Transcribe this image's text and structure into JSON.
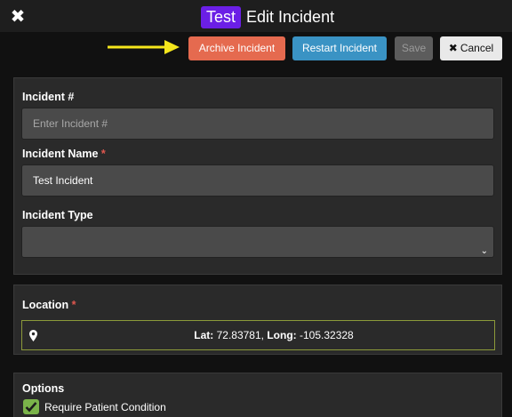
{
  "header": {
    "close_icon": "close-x-icon",
    "badge": "Test",
    "title": "Edit Incident",
    "badge_color": "#6b1fe6"
  },
  "toolbar": {
    "archive_label": "Archive Incident",
    "restart_label": "Restart Incident",
    "save_label": "Save",
    "cancel_label": "Cancel",
    "cancel_icon": "✖",
    "archive_color": "#e56a4f",
    "restart_color": "#3a93c4"
  },
  "form": {
    "incident_number": {
      "label": "Incident #",
      "placeholder": "Enter Incident #",
      "value": ""
    },
    "incident_name": {
      "label": "Incident Name",
      "required_marker": "*",
      "value": "Test Incident"
    },
    "incident_type": {
      "label": "Incident Type",
      "value": ""
    }
  },
  "location": {
    "label": "Location",
    "required_marker": "*",
    "lat_label": "Lat:",
    "lat": "72.83781",
    "long_label": "Long:",
    "long": "-105.32328"
  },
  "options": {
    "label": "Options",
    "require_patient_condition": {
      "label": "Require Patient Condition",
      "checked": true
    }
  }
}
